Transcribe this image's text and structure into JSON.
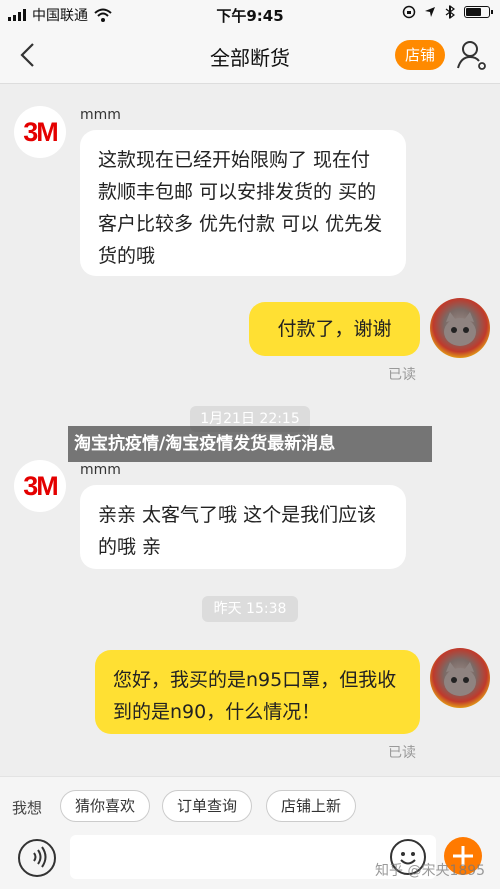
{
  "status_bar": {
    "carrier": "中国联通",
    "time": "下午9:45"
  },
  "nav": {
    "title": "全部断货",
    "shop_button": "店铺"
  },
  "messages": [
    {
      "sender": "mmm",
      "text": "这款现在已经开始限购了 现在付款顺丰包邮 可以安排发货的 买的客户比较多 优先付款 可以 优先发货的哦"
    },
    {
      "text": "付款了，谢谢",
      "status": "已读"
    },
    {
      "sender": "mmm",
      "text": "亲亲 太客气了哦 这个是我们应该的哦 亲"
    },
    {
      "text": "您好，我买的是n95口罩，但我收到的是n90，什么情况！",
      "status": "已读"
    }
  ],
  "timestamps": [
    "1月21日 22:15",
    "昨天 15:38"
  ],
  "avatar_logo": "3M",
  "banner": "淘宝抗疫情/淘宝疫情发货最新消息",
  "quick_replies": {
    "label": "我想",
    "chips": [
      "猜你喜欢",
      "订单查询",
      "店铺上新"
    ]
  },
  "watermark": "知乎 @宋央1895",
  "colors": {
    "accent": "#ff8a00",
    "my_bubble": "#ffe033",
    "logo_red": "#e40000"
  }
}
